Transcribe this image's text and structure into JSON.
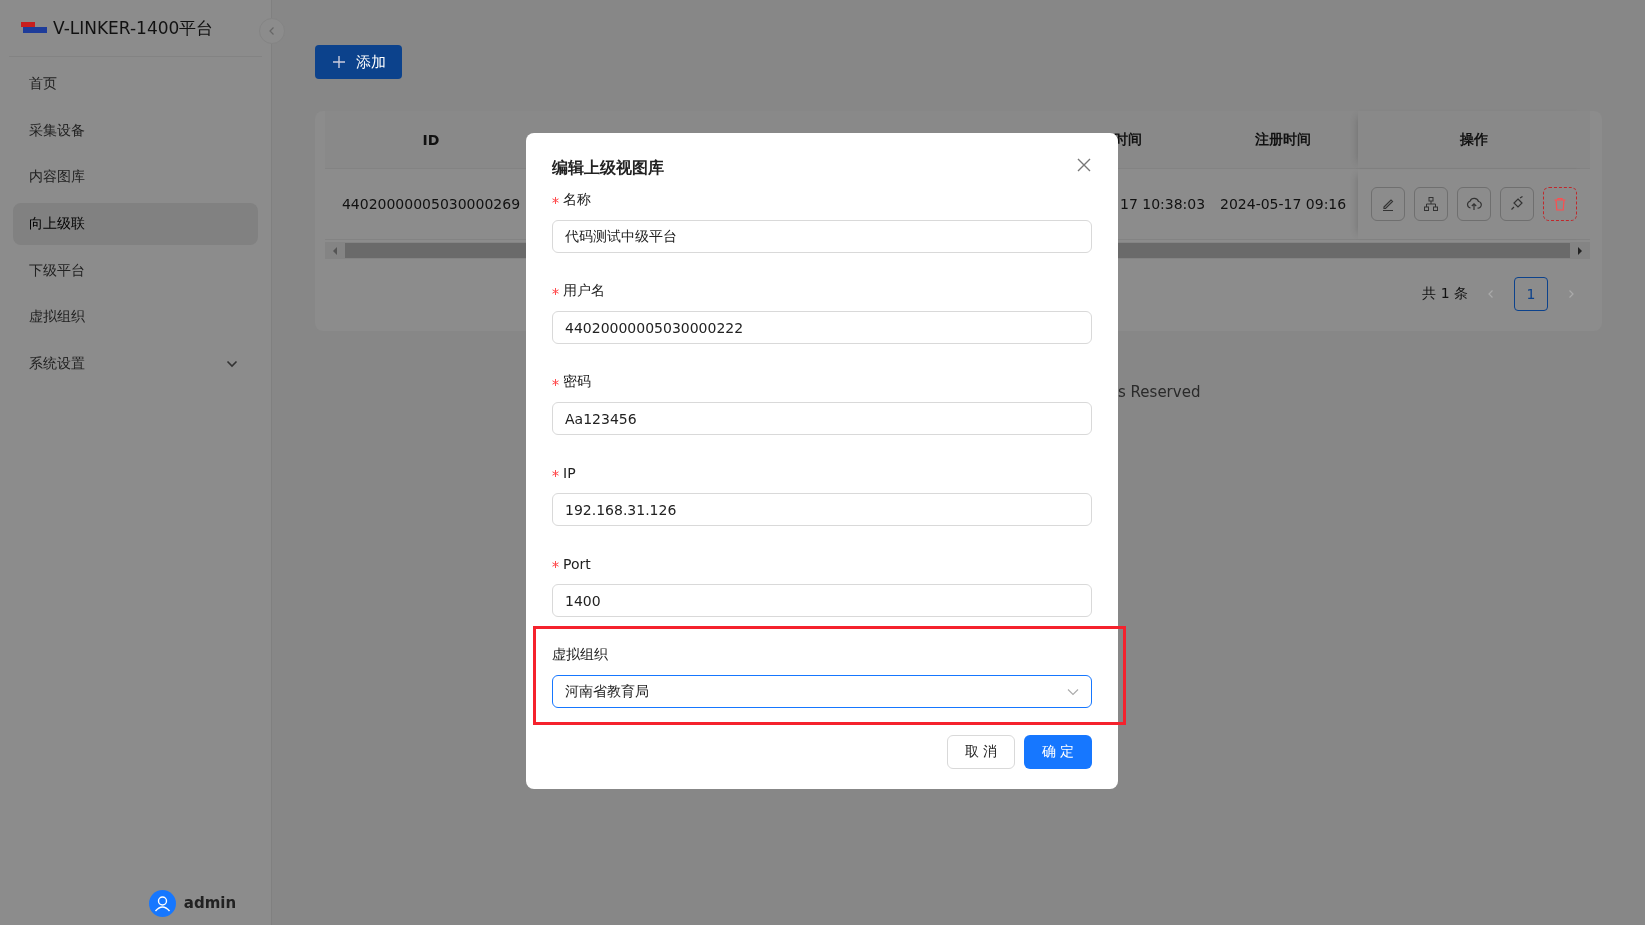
{
  "sidebar": {
    "title": "V-LINKER-1400平台",
    "items": [
      {
        "label": "首页",
        "selected": false,
        "has_submenu": false
      },
      {
        "label": "采集设备",
        "selected": false,
        "has_submenu": false
      },
      {
        "label": "内容图库",
        "selected": false,
        "has_submenu": false
      },
      {
        "label": "向上级联",
        "selected": true,
        "has_submenu": false
      },
      {
        "label": "下级平台",
        "selected": false,
        "has_submenu": false
      },
      {
        "label": "虚拟组织",
        "selected": false,
        "has_submenu": false
      },
      {
        "label": "系统设置",
        "selected": false,
        "has_submenu": true
      }
    ],
    "user": "admin"
  },
  "toolbar": {
    "add_button": "添加"
  },
  "table": {
    "columns": [
      "ID",
      "时间",
      "注册时间",
      "操作"
    ],
    "rows": [
      {
        "cells": [
          "44020000005030000269",
          "17 10:38:03",
          "2024-05-17 09:16"
        ],
        "actions": [
          {
            "kind": "edit"
          },
          {
            "kind": "tree"
          },
          {
            "kind": "upload"
          },
          {
            "kind": "link"
          },
          {
            "kind": "delete"
          }
        ]
      }
    ]
  },
  "pagination": {
    "total": "共 1 条",
    "pages": [
      {
        "label": "1",
        "selected": true
      }
    ]
  },
  "footer": "s Reserved",
  "dialog": {
    "title": "编辑上级视图库",
    "fields": [
      {
        "label": "名称",
        "required": true,
        "kind": "input",
        "value": "代码测试中级平台",
        "highlighted": false
      },
      {
        "label": "用户名",
        "required": true,
        "kind": "input",
        "value": "44020000005030000222",
        "highlighted": false
      },
      {
        "label": "密码",
        "required": true,
        "kind": "input",
        "value": "Aa123456",
        "highlighted": false
      },
      {
        "label": "IP",
        "required": true,
        "kind": "input",
        "value": "192.168.31.126",
        "highlighted": false
      },
      {
        "label": "Port",
        "required": true,
        "kind": "input",
        "value": "1400",
        "highlighted": false
      },
      {
        "label": "虚拟组织",
        "required": false,
        "kind": "select",
        "value": "河南省教育局",
        "highlighted": true
      }
    ],
    "buttons": [
      {
        "label": "取 消",
        "kind": "default"
      },
      {
        "label": "确 定",
        "kind": "primary"
      }
    ]
  }
}
